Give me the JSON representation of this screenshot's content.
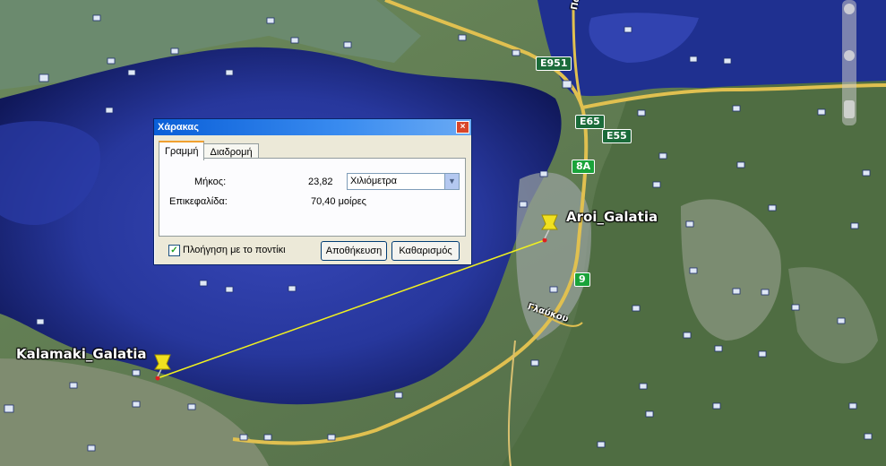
{
  "map": {
    "placemarks": [
      {
        "label": "Kalamaki_Galatia"
      },
      {
        "label": "Aroi_Galatia"
      }
    ],
    "road_shields": [
      "E951",
      "E65",
      "E55",
      "8A",
      "9"
    ],
    "road_names": [
      "Γλαύκου",
      "Πατ..."
    ],
    "colors": {
      "water": "#1c2f8a",
      "land": "#5d7350",
      "road": "#e0c050",
      "ruler_line": "#f0f020"
    }
  },
  "dialog": {
    "title": "Χάρακας",
    "tabs": [
      {
        "label": "Γραμμή",
        "active": true
      },
      {
        "label": "Διαδρομή",
        "active": false
      }
    ],
    "length_label": "Μήκος:",
    "length_value": "23,82",
    "unit_selected": "Χιλιόμετρα",
    "heading_label": "Επικεφαλίδα:",
    "heading_value": "70,40 μοίρες",
    "mouse_nav_label": "Πλοήγηση με το ποντίκι",
    "mouse_nav_checked": true,
    "save_label": "Αποθήκευση",
    "clear_label": "Καθαρισμός"
  }
}
